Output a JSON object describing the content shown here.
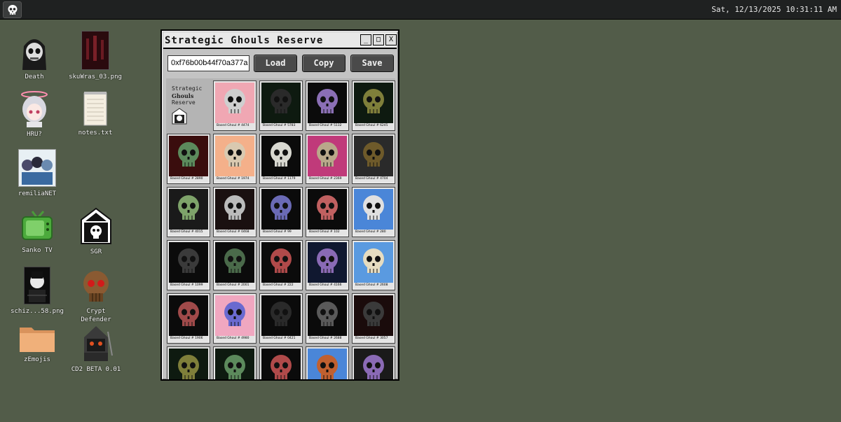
{
  "taskbar": {
    "clock": "Sat, 12/13/2025 10:31:11 AM",
    "start_icon": "skull-icon"
  },
  "desktop_icons": [
    {
      "label": "Death",
      "icon": "grim-reaper-icon"
    },
    {
      "label": "skuWras_03.png",
      "icon": "image-file-icon"
    },
    {
      "label": "HRU?",
      "icon": "anime-girl-icon"
    },
    {
      "label": "notes.txt",
      "icon": "notepad-icon"
    },
    {
      "label": "remiliaNET",
      "icon": "group-photo-icon"
    },
    {
      "label": "Sanko TV",
      "icon": "tv-icon"
    },
    {
      "label": "SGR",
      "icon": "temple-skull-icon"
    },
    {
      "label": "schiz...58.png",
      "icon": "image-file-icon"
    },
    {
      "label": "Crypt\nDefender",
      "icon": "red-eyed-skull-icon"
    },
    {
      "label": "zEmojis",
      "icon": "folder-icon"
    },
    {
      "label": "CD2 BETA 0.01",
      "icon": "helmet-warrior-icon"
    }
  ],
  "window": {
    "title": "Strategic Ghouls Reserve",
    "address": "0xf76b00b44f70a377a",
    "buttons": {
      "load": "Load",
      "copy": "Copy",
      "save": "Save"
    },
    "logo": {
      "line1": "Strategic",
      "line2": "Ghouls",
      "line3": "Reserve"
    },
    "cards": [
      {
        "caption": "Based Ghoul # 4474",
        "bg": "#f0a7b3",
        "skull": "#cfcfcf"
      },
      {
        "caption": "Based Ghoul # 5783",
        "bg": "#0e1a10",
        "skull": "#2a2a2a"
      },
      {
        "caption": "Based Ghoul # 5132",
        "bg": "#0b0b0b",
        "skull": "#8b6fb5"
      },
      {
        "caption": "Based Ghoul # 6245",
        "bg": "#0e1a10",
        "skull": "#7f7f3a"
      },
      {
        "caption": "Based Ghoul # 2890",
        "bg": "#3a0d0d",
        "skull": "#5c8a5c"
      },
      {
        "caption": "Based Ghoul # 1974",
        "bg": "#f4b08a",
        "skull": "#d9c9b0"
      },
      {
        "caption": "Based Ghoul # 1179",
        "bg": "#0b0b0b",
        "skull": "#d8d8d0"
      },
      {
        "caption": "Based Ghoul # 2369",
        "bg": "#c03a7a",
        "skull": "#b9a88a"
      },
      {
        "caption": "Based Ghoul # 4704",
        "bg": "#2a2a2a",
        "skull": "#6e5a2a"
      },
      {
        "caption": "Based Ghoul # 4015",
        "bg": "#1a1a1a",
        "skull": "#7ea36a"
      },
      {
        "caption": "Based Ghoul # 0468",
        "bg": "#1a1010",
        "skull": "#bbbbbb"
      },
      {
        "caption": "Based Ghoul # 99",
        "bg": "#0b0b0b",
        "skull": "#6a6ab5"
      },
      {
        "caption": "Based Ghoul # 102",
        "bg": "#0b0b0b",
        "skull": "#c06060"
      },
      {
        "caption": "Based Ghoul # 280",
        "bg": "#4a86d8",
        "skull": "#e0e0e0"
      },
      {
        "caption": "Based Ghoul # 1099",
        "bg": "#0b0b0b",
        "skull": "#3a3a3a"
      },
      {
        "caption": "Based Ghoul # 2001",
        "bg": "#0b0b0b",
        "skull": "#4a6a4a"
      },
      {
        "caption": "Based Ghoul # 222",
        "bg": "#0b0b0b",
        "skull": "#b04a4a"
      },
      {
        "caption": "Based Ghoul # 4166",
        "bg": "#101830",
        "skull": "#8a6ab5"
      },
      {
        "caption": "Based Ghoul # 2608",
        "bg": "#5a9ae0",
        "skull": "#e6dcc0"
      },
      {
        "caption": "Based Ghoul # 1906",
        "bg": "#0b0b0b",
        "skull": "#a04a4a"
      },
      {
        "caption": "Based Ghoul # 4980",
        "bg": "#f0a7c0",
        "skull": "#6a6ad0"
      },
      {
        "caption": "Based Ghoul # 0421",
        "bg": "#0b0b0b",
        "skull": "#2a2a2a"
      },
      {
        "caption": "Based Ghoul # 2688",
        "bg": "#0b0b0b",
        "skull": "#5a5a5a"
      },
      {
        "caption": "Based Ghoul # 3057",
        "bg": "#1a0b0b",
        "skull": "#3a3a3a"
      },
      {
        "caption": "",
        "bg": "#0e1a10",
        "skull": "#7f7f3a"
      },
      {
        "caption": "",
        "bg": "#0e1a10",
        "skull": "#5c8a5c"
      },
      {
        "caption": "",
        "bg": "#0b0b0b",
        "skull": "#b04a4a"
      },
      {
        "caption": "",
        "bg": "#4a86d8",
        "skull": "#c06030"
      },
      {
        "caption": "",
        "bg": "#1a1a1a",
        "skull": "#8a6ab5"
      }
    ]
  }
}
